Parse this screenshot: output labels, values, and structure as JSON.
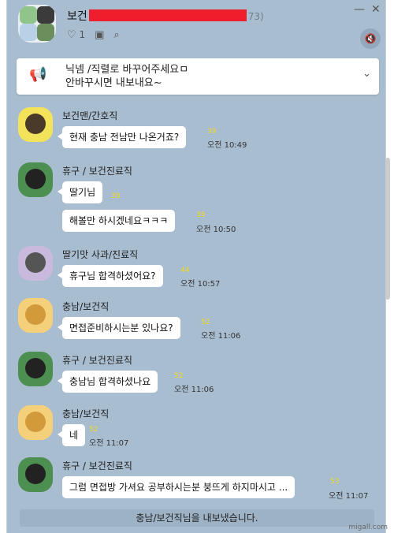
{
  "chat": {
    "title_prefix": "보건",
    "member_count": "73)",
    "likes": "1",
    "icons": {
      "like": "heart-icon",
      "album": "album-icon",
      "search": "search-icon",
      "mute": "mute-icon"
    }
  },
  "notice": {
    "line1": "닉넴 /직렬로  바꾸어주세요ㅁ",
    "line2": "안바꾸시면 내보내요~",
    "chevron": "⌄"
  },
  "messages": [
    {
      "name": "보건맨/간호직",
      "bubbles": [
        {
          "text": "현재 충남 전남만 나온거죠?",
          "unread": "39",
          "time": "오전 10:49"
        }
      ]
    },
    {
      "name": "휴구 / 보건진료직",
      "bubbles": [
        {
          "text": "딸기님",
          "unread": "39",
          "time": ""
        },
        {
          "text": "해볼만 하시겠네요ㅋㅋㅋ",
          "unread": "39",
          "time": "오전 10:50"
        }
      ]
    },
    {
      "name": "딸기맛 사과/진료직",
      "bubbles": [
        {
          "text": "휴구님 합격하셨어요?",
          "unread": "44",
          "time": "오전 10:57"
        }
      ]
    },
    {
      "name": "충남/보건직",
      "bubbles": [
        {
          "text": "면접준비하시는분 있나요?",
          "unread": "52",
          "time": "오전 11:06"
        }
      ]
    },
    {
      "name": "휴구 / 보건진료직",
      "bubbles": [
        {
          "text": "충남님 합격하셨나요",
          "unread": "52",
          "time": "오전 11:06"
        }
      ]
    },
    {
      "name": "충남/보건직",
      "bubbles": [
        {
          "text": "네",
          "unread": "52",
          "time": "오전 11:07"
        }
      ]
    },
    {
      "name": "휴구 / 보건진료직",
      "bubbles": [
        {
          "text": "그럼 면접방 가셔요 공부하시는분 붕뜨게 하지마시고 ...",
          "unread": "53",
          "time": "오전 11:07"
        }
      ]
    }
  ],
  "system_message": "충남/보건직님을 내보냈습니다.",
  "watermark": "migall.com"
}
